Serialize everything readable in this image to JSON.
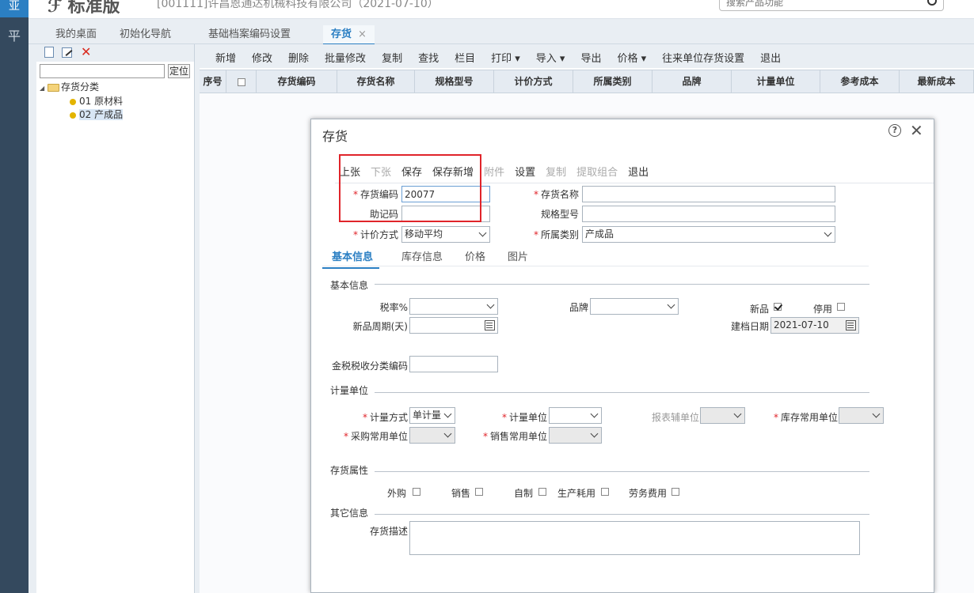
{
  "app": {
    "logo": "亚",
    "rail_glyph": "平",
    "brand": "标准版",
    "company": "[001111]许昌恩通达机械科技有限公司（2021-07-10）",
    "search_placeholder": "搜索产品功能"
  },
  "tabs": [
    {
      "label": "我的桌面"
    },
    {
      "label": "初始化导航"
    },
    {
      "label": "基础档案编码设置"
    },
    {
      "label": "存货",
      "close": "×"
    }
  ],
  "tree_panel": {
    "locate_label": "定位",
    "root": "存货分类",
    "children": [
      "01 原材料",
      "02 产成品"
    ]
  },
  "toolbar": [
    "新增",
    "修改",
    "删除",
    "批量修改",
    "复制",
    "查找",
    "栏目",
    "打印 ▾",
    "导入 ▾",
    "导出",
    "价格 ▾",
    "往来单位存货设置",
    "退出"
  ],
  "grid_headers": [
    "序号",
    "",
    "存货编码",
    "存货名称",
    "规格型号",
    "计价方式",
    "所属类别",
    "品牌",
    "计量单位",
    "参考成本",
    "最新成本"
  ],
  "dialog": {
    "title": "存货",
    "toolbar": [
      {
        "label": "上张",
        "enabled": true
      },
      {
        "label": "下张",
        "enabled": false
      },
      {
        "label": "保存",
        "enabled": true
      },
      {
        "label": "保存新增",
        "enabled": true
      },
      {
        "label": "附件",
        "enabled": false
      },
      {
        "label": "设置",
        "enabled": true
      },
      {
        "label": "复制",
        "enabled": false
      },
      {
        "label": "提取组合",
        "enabled": false
      },
      {
        "label": "退出",
        "enabled": true
      }
    ],
    "fields": {
      "code_label": "存货编码",
      "code_value": "20077",
      "name_label": "存货名称",
      "name_value": "",
      "mnemonic_label": "助记码",
      "mnemonic_value": "",
      "spec_label": "规格型号",
      "spec_value": "",
      "valuation_label": "计价方式",
      "valuation_value": "移动平均",
      "category_label": "所属类别",
      "category_value": "产成品"
    },
    "subtabs": [
      "基本信息",
      "库存信息",
      "价格",
      "图片"
    ],
    "basic": {
      "section": "基本信息",
      "tax_label": "税率%",
      "tax_value": "",
      "brand_label": "品牌",
      "brand_value": "",
      "new_label": "新品",
      "new_checked": true,
      "disabled_label": "停用",
      "disabled_checked": false,
      "new_period_label": "新品周期(天)",
      "new_period_value": "",
      "created_label": "建档日期",
      "created_value": "2021-07-10",
      "tax_code_label": "金税税收分类编码",
      "tax_code_value": ""
    },
    "units": {
      "section": "计量单位",
      "mode_label": "计量方式",
      "mode_value": "单计量",
      "unit_label": "计量单位",
      "unit_value": "",
      "report_aux_label": "报表辅单位",
      "report_aux_value": "",
      "stock_unit_label": "库存常用单位",
      "stock_unit_value": "",
      "purchase_unit_label": "采购常用单位",
      "purchase_unit_value": "",
      "sales_unit_label": "销售常用单位",
      "sales_unit_value": ""
    },
    "attributes": {
      "section": "存货属性",
      "items": [
        {
          "label": "外购",
          "checked": false
        },
        {
          "label": "销售",
          "checked": false
        },
        {
          "label": "自制",
          "checked": false
        },
        {
          "label": "生产耗用",
          "checked": false
        },
        {
          "label": "劳务费用",
          "checked": false
        }
      ]
    },
    "other": {
      "section": "其它信息",
      "desc_label": "存货描述",
      "desc_value": ""
    }
  },
  "colors": {
    "accent": "#2b7fc3",
    "highlight_box": "#e0242a",
    "rail": "#34495e"
  }
}
